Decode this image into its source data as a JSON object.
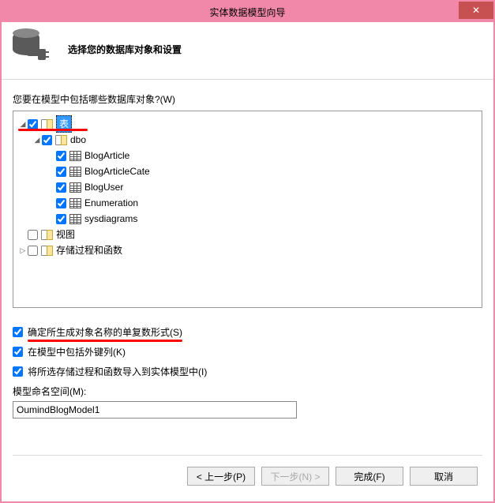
{
  "title": "实体数据模型向导",
  "close_glyph": "✕",
  "header_text": "选择您的数据库对象和设置",
  "question": "您要在模型中包括哪些数据库对象?(W)",
  "tree": {
    "root": {
      "label": "表",
      "checked": true
    },
    "dbo": {
      "label": "dbo",
      "checked": true
    },
    "tables": [
      {
        "label": "BlogArticle",
        "checked": true
      },
      {
        "label": "BlogArticleCate",
        "checked": true
      },
      {
        "label": "BlogUser",
        "checked": true
      },
      {
        "label": "Enumeration",
        "checked": true
      },
      {
        "label": "sysdiagrams",
        "checked": true
      }
    ],
    "views": {
      "label": "视图",
      "checked": false
    },
    "procs": {
      "label": "存储过程和函数",
      "checked": false
    }
  },
  "options": {
    "plural": {
      "label": "确定所生成对象名称的单复数形式(S)",
      "checked": true
    },
    "fk": {
      "label": "在模型中包括外键列(K)",
      "checked": true
    },
    "sp": {
      "label": "将所选存储过程和函数导入到实体模型中(I)",
      "checked": true
    }
  },
  "ns": {
    "label": "模型命名空间(M):",
    "value": "OumindBlogModel1"
  },
  "buttons": {
    "prev": "< 上一步(P)",
    "next": "下一步(N) >",
    "finish": "完成(F)",
    "cancel": "取消"
  }
}
